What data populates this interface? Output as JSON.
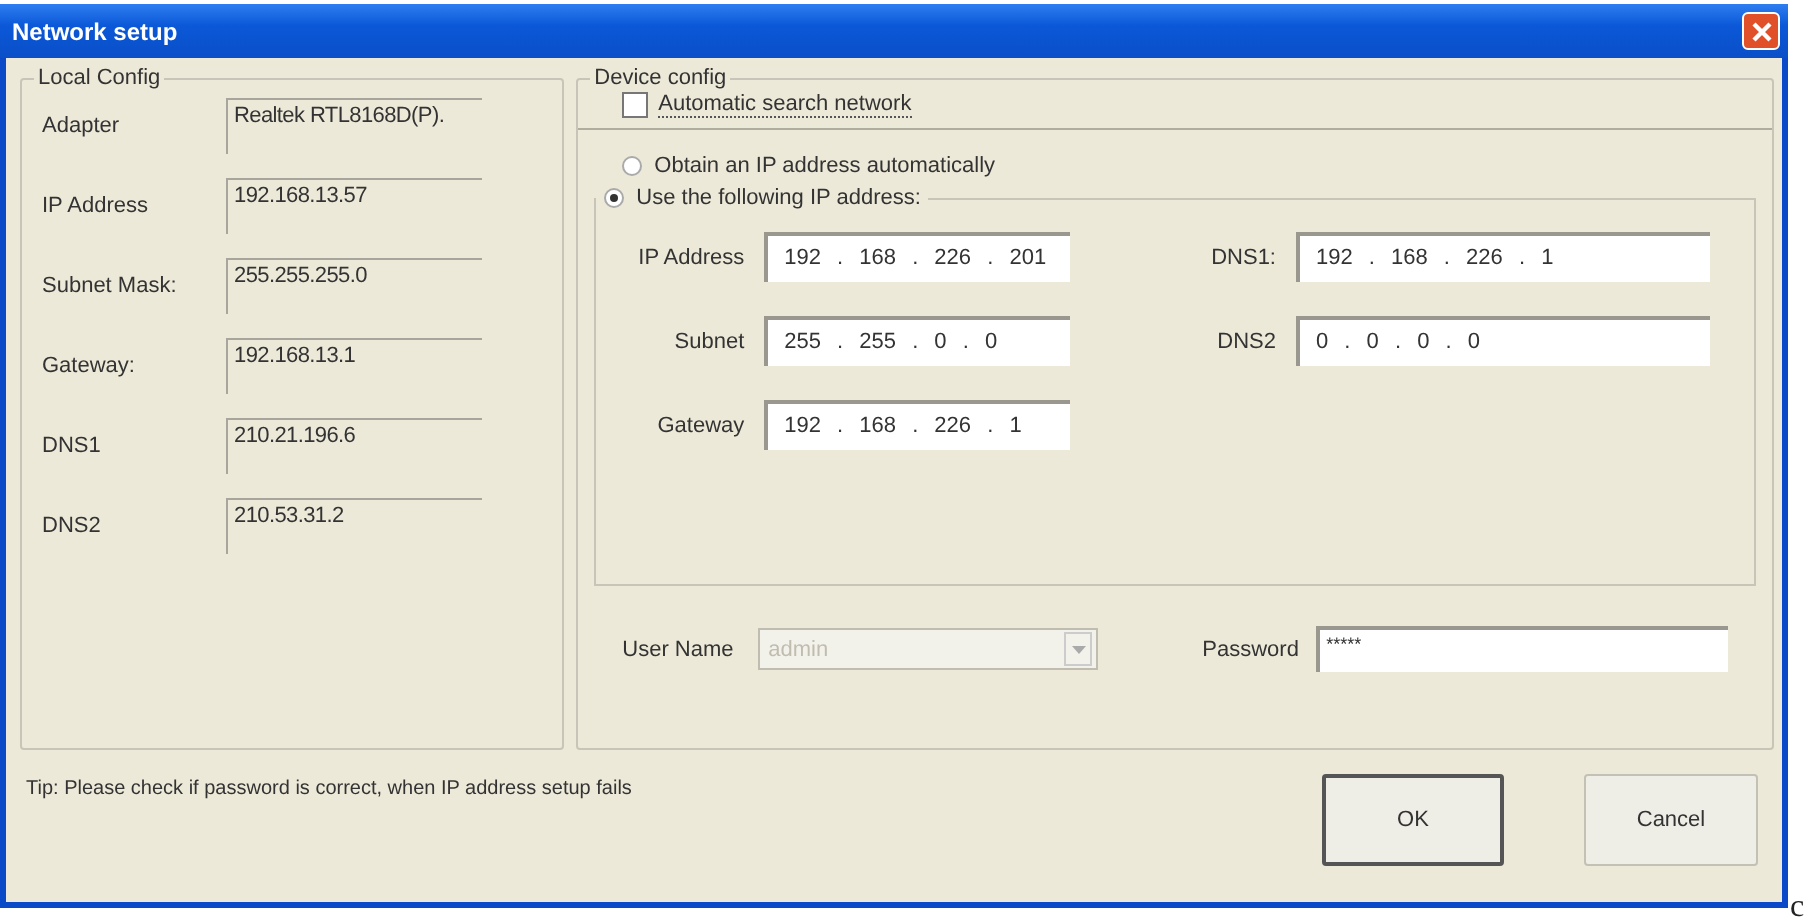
{
  "window": {
    "title": "Network setup"
  },
  "local_config": {
    "title": "Local Config",
    "rows": [
      {
        "label": "Adapter",
        "value": "Realtek RTL8168D(P)."
      },
      {
        "label": "IP Address",
        "value": "192.168.13.57"
      },
      {
        "label": "Subnet Mask:",
        "value": "255.255.255.0"
      },
      {
        "label": "Gateway:",
        "value": "192.168.13.1"
      },
      {
        "label": "DNS1",
        "value": "210.21.196.6"
      },
      {
        "label": "DNS2",
        "value": "210.53.31.2"
      }
    ]
  },
  "device_config": {
    "title": "Device config",
    "auto_search": {
      "label": "Automatic search network",
      "checked": false
    },
    "modes": [
      {
        "label": "Obtain an IP address automatically",
        "selected": false
      },
      {
        "label": "Use the following IP address:",
        "selected": true
      }
    ],
    "left_fields": [
      {
        "label": "IP Address",
        "value": "192 . 168 . 226 . 201"
      },
      {
        "label": "Subnet",
        "value": "255 . 255 . 0 . 0"
      },
      {
        "label": "Gateway",
        "value": "192 . 168 . 226 . 1"
      }
    ],
    "right_fields": [
      {
        "label": "DNS1:",
        "value": "192 . 168 . 226 . 1"
      },
      {
        "label": "DNS2",
        "value": "0 . 0 . 0 . 0"
      }
    ],
    "user_name": {
      "label": "User Name",
      "value": "admin",
      "disabled": true
    },
    "password": {
      "label": "Password",
      "value": "*****"
    }
  },
  "tip": "Tip:  Please check if password is correct, when IP address setup fails",
  "buttons": [
    {
      "label": "OK",
      "default": true
    },
    {
      "label": "Cancel",
      "default": false
    }
  ],
  "stray_text": "c"
}
